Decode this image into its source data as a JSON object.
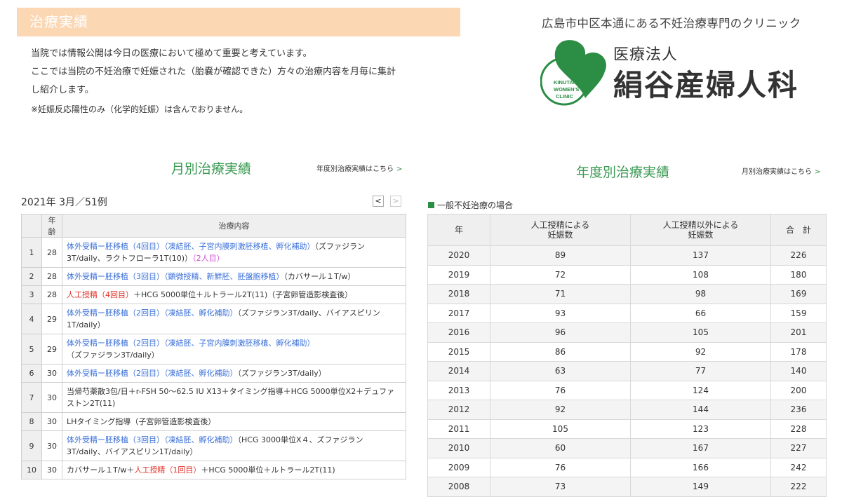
{
  "banner": {
    "title": "治療実績"
  },
  "intro": {
    "line1": "当院では情報公開は今日の医療において極めて重要と考えています。",
    "line2": "ここでは当院の不妊治療で妊娠された（胎嚢が確認できた）方々の治療内容を月毎に集計",
    "line3": "し紹介します。",
    "note": "※妊娠反応陽性のみ（化学的妊娠）は含んでおりません。"
  },
  "clinic": {
    "tagline": "広島市中区本通にある不妊治療専門のクリニック",
    "logo_line1": "医療法人",
    "logo_line2": "絹谷産婦人科",
    "logo_mark_1": "KINUTANI",
    "logo_mark_2": "WOMEN'S",
    "logo_mark_3": "CLINIC"
  },
  "monthly": {
    "title": "月別治療実績",
    "link": "年度別治療実績はこちら",
    "link_arrow": ">",
    "period": "2021年 3月／51例",
    "prev": "<",
    "next": ">",
    "col_age": "年齢",
    "col_content": "治療内容",
    "rows": [
      {
        "no": "1",
        "age": "28",
        "parts": [
          {
            "t": "体外受精ー胚移植（4回目）（凍結胚、子宮内膜刺激胚移植、孵化補助）",
            "c": "blue"
          },
          {
            "t": "（ズファジラン3T/daily、ラクトフローラ1T(10)）",
            "c": ""
          },
          {
            "t": "（2人目）",
            "c": "pink"
          }
        ]
      },
      {
        "no": "2",
        "age": "28",
        "parts": [
          {
            "t": "体外受精ー胚移植（3回目）（顕微授精、新鮮胚、胚盤胞移植）",
            "c": "blue"
          },
          {
            "t": "（カバサール１T/w）",
            "c": ""
          }
        ]
      },
      {
        "no": "3",
        "age": "28",
        "parts": [
          {
            "t": "人工授精（4回目）",
            "c": "red"
          },
          {
            "t": "＋HCG 5000単位＋ルトラール2T(11)（子宮卵管造影検査後）",
            "c": ""
          }
        ]
      },
      {
        "no": "4",
        "age": "29",
        "parts": [
          {
            "t": "体外受精ー胚移植（2回目）（凍結胚、孵化補助）",
            "c": "blue"
          },
          {
            "t": "（ズファジラン3T/daily、バイアスピリン1T/daily）",
            "c": ""
          }
        ]
      },
      {
        "no": "5",
        "age": "29",
        "parts": [
          {
            "t": "体外受精ー胚移植（2回目）（凍結胚、子宮内膜刺激胚移植、孵化補助）",
            "c": "blue"
          },
          {
            "t": "（ズファジラン3T/daily）",
            "c": ""
          }
        ]
      },
      {
        "no": "6",
        "age": "30",
        "parts": [
          {
            "t": "体外受精ー胚移植（2回目）（凍結胚、孵化補助）",
            "c": "blue"
          },
          {
            "t": "（ズファジラン3T/daily）",
            "c": ""
          }
        ]
      },
      {
        "no": "7",
        "age": "30",
        "parts": [
          {
            "t": "当帰芍薬散3包/日＋r-FSH 50～62.5 IU X13＋タイミング指導＋HCG 5000単位X2＋デュファストン2T(11)",
            "c": ""
          }
        ]
      },
      {
        "no": "8",
        "age": "30",
        "parts": [
          {
            "t": "LHタイミング指導（子宮卵管造影検査後）",
            "c": ""
          }
        ]
      },
      {
        "no": "9",
        "age": "30",
        "parts": [
          {
            "t": "体外受精ー胚移植（3回目）（凍結胚、孵化補助）",
            "c": "blue"
          },
          {
            "t": "（HCG 3000単位X４、ズファジラン3T/daily、バイアスピリン1T/daily）",
            "c": ""
          }
        ]
      },
      {
        "no": "10",
        "age": "30",
        "parts": [
          {
            "t": "カバサール１T/w＋",
            "c": ""
          },
          {
            "t": "人工授精（1回目）",
            "c": "red"
          },
          {
            "t": "＋HCG 5000単位＋ルトラール2T(11)",
            "c": ""
          }
        ]
      }
    ]
  },
  "yearly": {
    "title": "年度別治療実績",
    "link": "月別治療実績はこちら",
    "link_arrow": ">",
    "subhead": "一般不妊治療の場合",
    "col_year": "年",
    "col_ai_1": "人工授精による",
    "col_ai_2": "妊娠数",
    "col_other_1": "人工授精以外による",
    "col_other_2": "妊娠数",
    "col_total": "合　計",
    "rows": [
      {
        "year": "2020",
        "ai": "89",
        "other": "137",
        "total": "226"
      },
      {
        "year": "2019",
        "ai": "72",
        "other": "108",
        "total": "180"
      },
      {
        "year": "2018",
        "ai": "71",
        "other": "98",
        "total": "169"
      },
      {
        "year": "2017",
        "ai": "93",
        "other": "66",
        "total": "159"
      },
      {
        "year": "2016",
        "ai": "96",
        "other": "105",
        "total": "201"
      },
      {
        "year": "2015",
        "ai": "86",
        "other": "92",
        "total": "178"
      },
      {
        "year": "2014",
        "ai": "63",
        "other": "77",
        "total": "140"
      },
      {
        "year": "2013",
        "ai": "76",
        "other": "124",
        "total": "200"
      },
      {
        "year": "2012",
        "ai": "92",
        "other": "144",
        "total": "236"
      },
      {
        "year": "2011",
        "ai": "105",
        "other": "123",
        "total": "228"
      },
      {
        "year": "2010",
        "ai": "60",
        "other": "167",
        "total": "227"
      },
      {
        "year": "2009",
        "ai": "76",
        "other": "166",
        "total": "242"
      },
      {
        "year": "2008",
        "ai": "73",
        "other": "149",
        "total": "222"
      }
    ]
  },
  "colors": {
    "accent_green": "#2c8d45",
    "banner_bg": "#fbd7b4",
    "link_blue": "#3a6fd8",
    "red": "#e0322a",
    "pink": "#d04fd0"
  }
}
